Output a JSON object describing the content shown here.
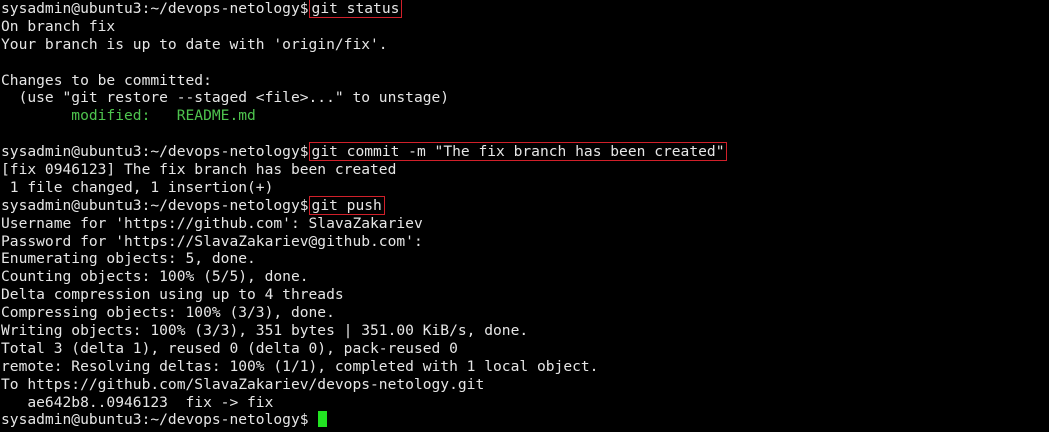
{
  "terminal": {
    "prompt": "sysadmin@ubuntu3:~/devops-netology$",
    "commands": {
      "status": "git status",
      "commit": "git commit -m \"The fix branch has been created\"",
      "push": "git push"
    },
    "status_output": {
      "l1": "On branch fix",
      "l2": "Your branch is up to date with 'origin/fix'.",
      "l3": "",
      "l4": "Changes to be committed:",
      "l5": "  (use \"git restore --staged <file>...\" to unstage)",
      "l6_label": "        modified:   ",
      "l6_file": "README.md",
      "l7": ""
    },
    "commit_output": {
      "l1": "[fix 0946123] The fix branch has been created",
      "l2": " 1 file changed, 1 insertion(+)"
    },
    "push_output": {
      "l1": "Username for 'https://github.com': SlavaZakariev",
      "l2": "Password for 'https://SlavaZakariev@github.com':",
      "l3": "Enumerating objects: 5, done.",
      "l4": "Counting objects: 100% (5/5), done.",
      "l5": "Delta compression using up to 4 threads",
      "l6": "Compressing objects: 100% (3/3), done.",
      "l7": "Writing objects: 100% (3/3), 351 bytes | 351.00 KiB/s, done.",
      "l8": "Total 3 (delta 1), reused 0 (delta 0), pack-reused 0",
      "l9": "remote: Resolving deltas: 100% (1/1), completed with 1 local object.",
      "l10": "To https://github.com/SlavaZakariev/devops-netology.git",
      "l11": "   ae642b8..0946123  fix -> fix"
    },
    "colors": {
      "background": "#000000",
      "text": "#e6e6e6",
      "modified": "#4ec44e",
      "highlight_box": "#d1202a",
      "cursor": "#22e322"
    }
  }
}
